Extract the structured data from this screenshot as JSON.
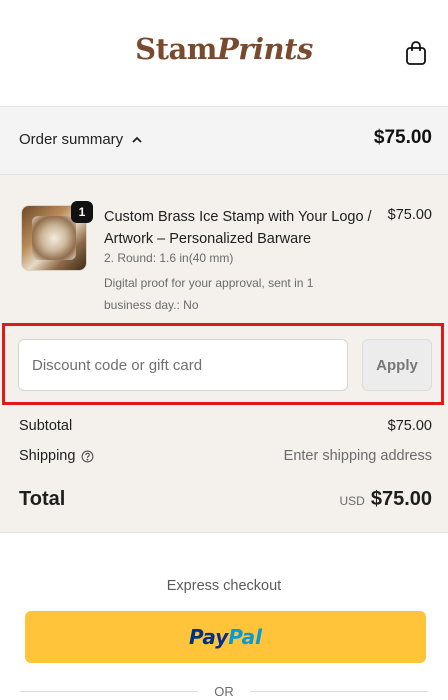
{
  "header": {
    "logo_prefix": "Stam",
    "logo_script": "Prints",
    "cart_icon": "shopping-bag-icon"
  },
  "summary": {
    "toggle_label": "Order summary",
    "toggle_icon": "chevron-up-icon",
    "total": "$75.00"
  },
  "product": {
    "quantity": "1",
    "title": "Custom Brass Ice Stamp with Your Logo / Artwork – Personalized Barware",
    "price": "$75.00",
    "variant": "2. Round: 1.6 in(40 mm)",
    "note": "Digital proof for your approval, sent in 1 business day.: No"
  },
  "discount": {
    "placeholder": "Discount code or gift card",
    "apply_label": "Apply"
  },
  "totals": {
    "subtotal_label": "Subtotal",
    "subtotal_value": "$75.00",
    "shipping_label": "Shipping",
    "shipping_value": "Enter shipping address",
    "total_label": "Total",
    "currency": "USD",
    "total_value": "$75.00"
  },
  "express": {
    "label": "Express checkout",
    "paypal_pay": "Pay",
    "paypal_pal": "Pal",
    "or_label": "OR"
  },
  "colors": {
    "highlight_border": "#e01919",
    "paypal_yellow": "#ffc439",
    "brand_brown": "#7a4a2e"
  }
}
